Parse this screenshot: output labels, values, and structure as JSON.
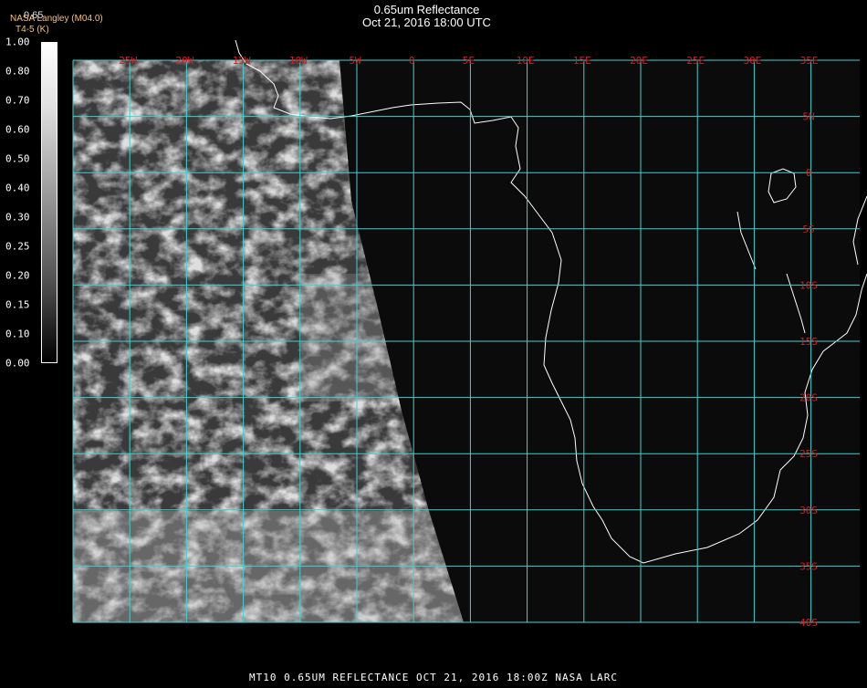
{
  "header": {
    "title": "0.65um Reflectance",
    "subtitle": "Oct 21, 2016 18:00 UTC"
  },
  "legend": {
    "source": "NASA Langley (M04.0)",
    "overlay_label": "0.65",
    "units_label": "T4-5 (K)",
    "ticks": [
      "1.00",
      "0.80",
      "0.70",
      "0.60",
      "0.50",
      "0.40",
      "0.30",
      "0.25",
      "0.20",
      "0.15",
      "0.10",
      "0.00"
    ]
  },
  "grid": {
    "lon_labels": [
      "25W",
      "20W",
      "15W",
      "10W",
      "5W",
      "0",
      "5E",
      "10E",
      "15E",
      "20E",
      "25E",
      "30E",
      "35E"
    ],
    "lat_labels": [
      "5N",
      "0",
      "5S",
      "10S",
      "15S",
      "20S",
      "25S",
      "30S",
      "35S",
      "40S"
    ],
    "grid_color": "#3fd1d1",
    "label_color": "#d21e1e"
  },
  "footer": {
    "caption": "MT10  0.65UM REFLECTANCE   OCT 21, 2016 18:00Z   NASA LARC"
  }
}
